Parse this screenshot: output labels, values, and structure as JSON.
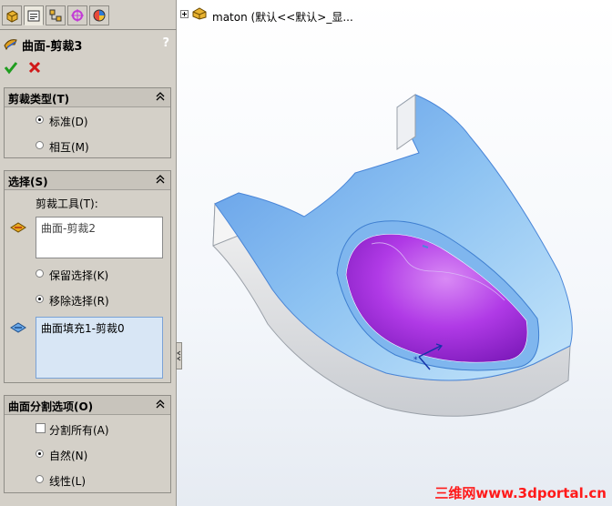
{
  "property_manager": {
    "tabs": [
      {
        "icon": "feature-manager-icon"
      },
      {
        "icon": "property-manager-icon"
      },
      {
        "icon": "configuration-manager-icon"
      },
      {
        "icon": "dimxpert-manager-icon"
      },
      {
        "icon": "display-manager-icon"
      }
    ],
    "title": "曲面-剪裁3",
    "help": "?",
    "trim_type": {
      "title": "剪裁类型(T)",
      "options": [
        {
          "label": "标准(D)",
          "selected": true
        },
        {
          "label": "相互(M)",
          "selected": false
        }
      ]
    },
    "selections": {
      "title": "选择(S)",
      "tool_label": "剪裁工具(T):",
      "tool_value": "曲面-剪裁2",
      "options": [
        {
          "label": "保留选择(K)",
          "selected": false
        },
        {
          "label": "移除选择(R)",
          "selected": true
        }
      ],
      "removed_value": "曲面填充1-剪裁0"
    },
    "split_options": {
      "title": "曲面分割选项(O)",
      "split_all": {
        "label": "分割所有(A)",
        "checked": false
      },
      "options": [
        {
          "label": "自然(N)",
          "selected": true
        },
        {
          "label": "线性(L)",
          "selected": false
        }
      ]
    }
  },
  "graphics": {
    "tree_label": "maton  (默认<<默认>_显...",
    "watermark": "三维网www.3dportal.cn"
  },
  "colors": {
    "panel_bg": "#d4d0c8",
    "surface_blue": "#6fb1ee",
    "trim_region": "#b43ae8",
    "ok_green": "#1f9d1f",
    "cancel_red": "#d01818",
    "watermark_red": "#ff1a1a"
  }
}
